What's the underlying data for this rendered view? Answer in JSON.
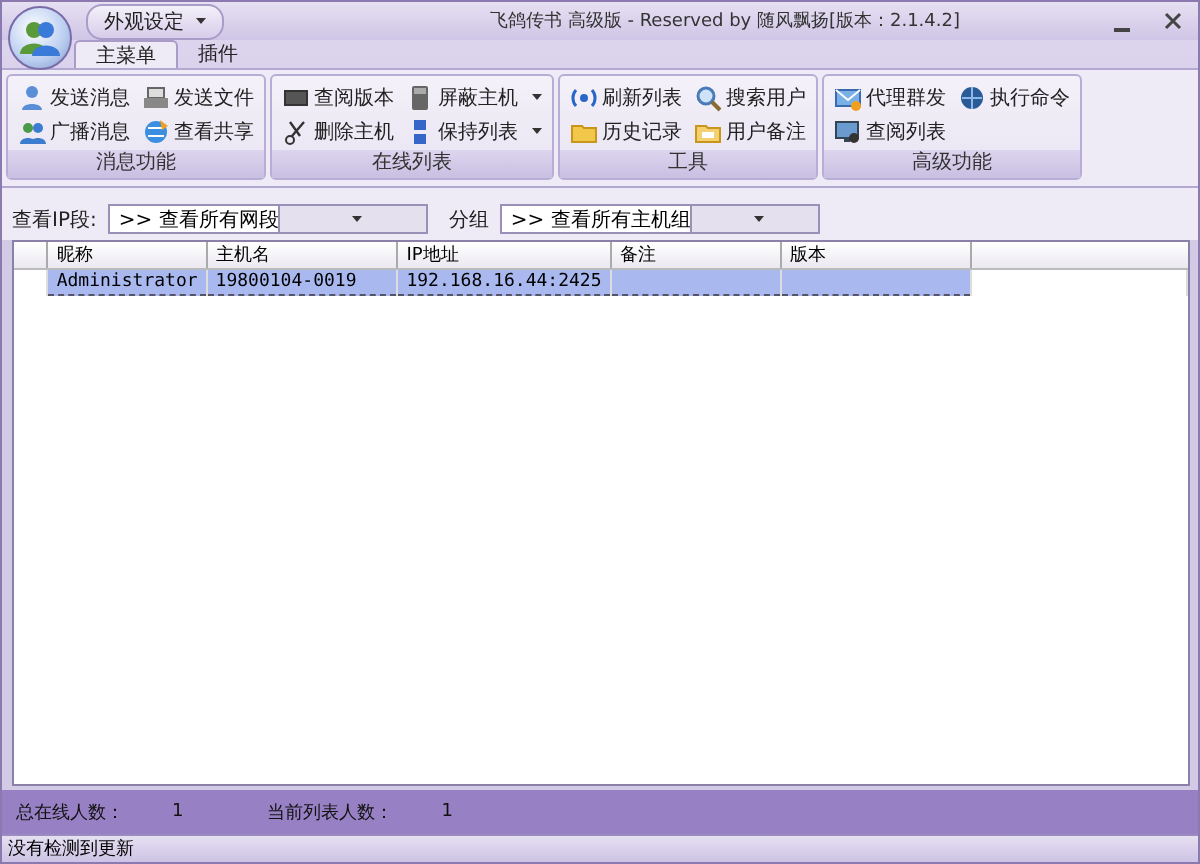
{
  "window": {
    "title": "飞鸽传书 高级版 - Reserved by 随风飘扬[版本：2.1.4.2]",
    "menu_button": "外观设定"
  },
  "tabs": [
    {
      "label": "主菜单",
      "selected": true
    },
    {
      "label": "插件",
      "selected": false
    }
  ],
  "ribbon_groups": [
    {
      "title": "消息功能",
      "items": [
        {
          "label": "发送消息",
          "kind": "message",
          "dropdown": false
        },
        {
          "label": "发送文件",
          "kind": "file",
          "dropdown": false
        },
        {
          "label": "广播消息",
          "kind": "broadcast",
          "dropdown": false
        },
        {
          "label": "查看共享",
          "kind": "share",
          "dropdown": false
        }
      ]
    },
    {
      "title": "在线列表",
      "items": [
        {
          "label": "查阅版本",
          "kind": "version",
          "dropdown": false
        },
        {
          "label": "屏蔽主机",
          "kind": "block",
          "dropdown": true
        },
        {
          "label": "删除主机",
          "kind": "delete",
          "dropdown": false
        },
        {
          "label": "保持列表",
          "kind": "keep",
          "dropdown": true
        }
      ]
    },
    {
      "title": "工具",
      "items": [
        {
          "label": "刷新列表",
          "kind": "refresh",
          "dropdown": false
        },
        {
          "label": "搜索用户",
          "kind": "search",
          "dropdown": false
        },
        {
          "label": "历史记录",
          "kind": "history",
          "dropdown": false
        },
        {
          "label": "用户备注",
          "kind": "note",
          "dropdown": false
        }
      ]
    },
    {
      "title": "高级功能",
      "items": [
        {
          "label": "代理群发",
          "kind": "proxy",
          "dropdown": false
        },
        {
          "label": "执行命令",
          "kind": "command",
          "dropdown": false
        },
        {
          "label": "查阅列表",
          "kind": "view",
          "dropdown": false
        }
      ]
    }
  ],
  "filters": [
    {
      "label": "查看IP段:",
      "value": ">> 查看所有网段"
    },
    {
      "label": "分组",
      "value": ">> 查看所有主机组"
    }
  ],
  "table": {
    "columns": [
      "昵称",
      "主机名",
      "IP地址",
      "备注",
      "版本"
    ],
    "rows": [
      {
        "cells": [
          "Administrator",
          "19800104-0019",
          "192.168.16.44:2425"
        ],
        "selected": true
      }
    ]
  },
  "stats": [
    {
      "label": "总在线人数：",
      "value": "1"
    },
    {
      "label": "当前列表人数：",
      "value": "1"
    }
  ],
  "status_bar": "没有检测到更新"
}
